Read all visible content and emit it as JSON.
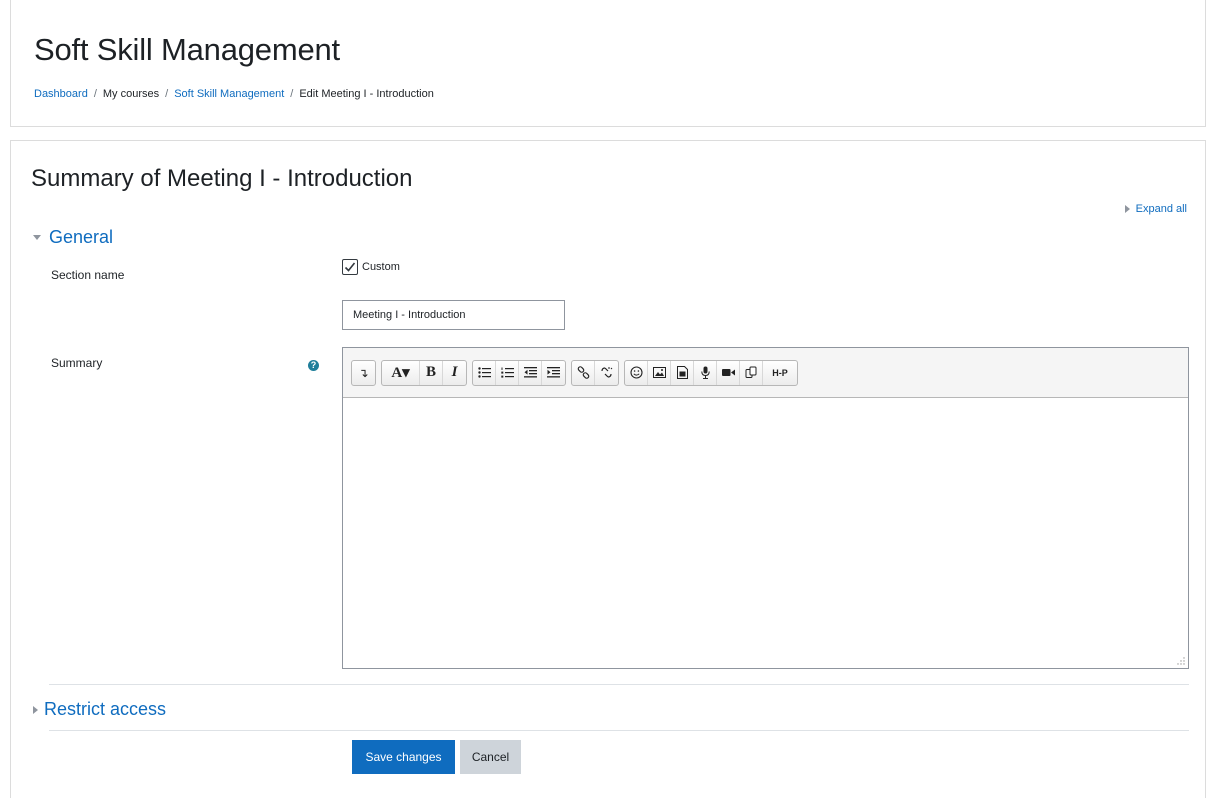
{
  "header": {
    "title": "Soft Skill Management",
    "breadcrumb": [
      "Dashboard",
      "My courses",
      "Soft Skill Management",
      "Edit Meeting I - Introduction"
    ],
    "breadcrumb_sep": "/"
  },
  "form": {
    "heading": "Summary of Meeting I - Introduction",
    "expand_all": "Expand all",
    "general_legend": "General",
    "section_name_label": "Section name",
    "custom_label": "Custom",
    "custom_checked": true,
    "section_name_value": "Meeting I - Introduction",
    "summary_label": "Summary",
    "help_glyph": "?",
    "restrict_legend": "Restrict access",
    "save_label": "Save changes",
    "cancel_label": "Cancel"
  },
  "toolbar": {
    "toggle": "↴",
    "font_color": "A▾",
    "bold": "B",
    "italic": "I",
    "h5p": "H-P"
  },
  "icons": [
    "collapse-arrow-icon",
    "font-color-icon",
    "bold-icon",
    "italic-icon",
    "unordered-list-icon",
    "ordered-list-icon",
    "outdent-icon",
    "indent-icon",
    "link-icon",
    "unlink-icon",
    "emoji-icon",
    "image-icon",
    "media-icon",
    "record-audio-icon",
    "record-video-icon",
    "manage-files-icon",
    "h5p-icon",
    "help-icon",
    "resize-grip-icon"
  ],
  "colors": {
    "link": "#0f6cbf",
    "primary": "#0f6cbf",
    "secondary": "#ced4da",
    "help": "#1f7e9a"
  }
}
